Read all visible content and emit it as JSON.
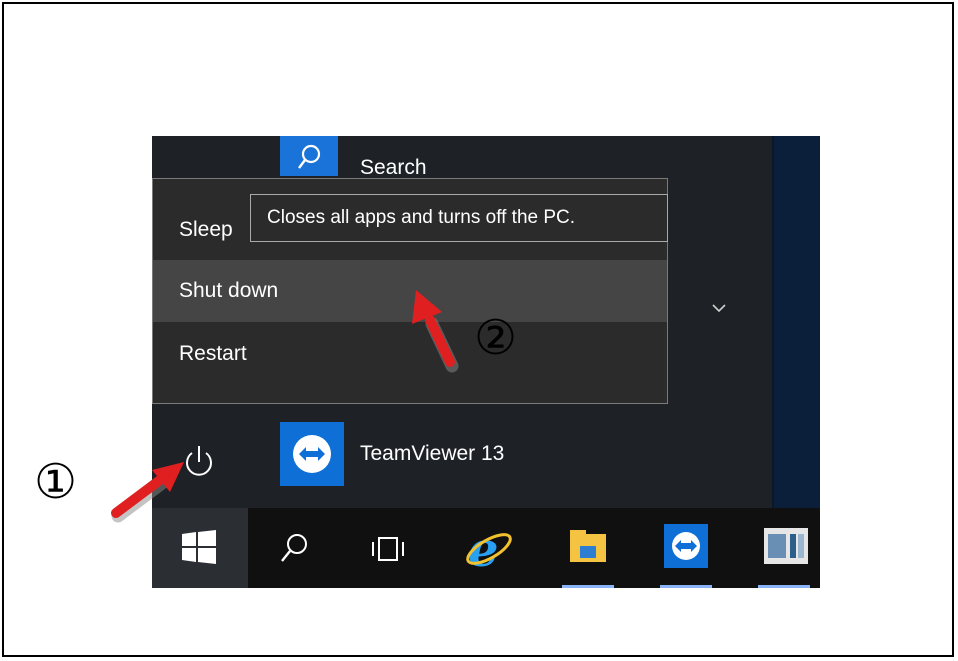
{
  "start_menu": {
    "search_label": "Search",
    "power_menu": {
      "items": [
        {
          "label": "Sleep"
        },
        {
          "label": "Shut down"
        },
        {
          "label": "Restart"
        }
      ],
      "tooltip": "Closes all apps and turns off the PC."
    },
    "pinned_app": {
      "label": "TeamViewer 13",
      "icon": "teamviewer-icon"
    }
  },
  "taskbar": {
    "items": [
      "windows-start-icon",
      "search-icon",
      "task-view-icon",
      "internet-explorer-icon",
      "file-explorer-icon",
      "teamviewer-icon",
      "app-icon"
    ]
  },
  "annotations": {
    "step1": "①",
    "step2": "②"
  },
  "colors": {
    "menu_bg": "#2b2b2b",
    "menu_highlight": "#454545",
    "tile_blue": "#1a73d9",
    "arrow_red": "#e02020"
  }
}
